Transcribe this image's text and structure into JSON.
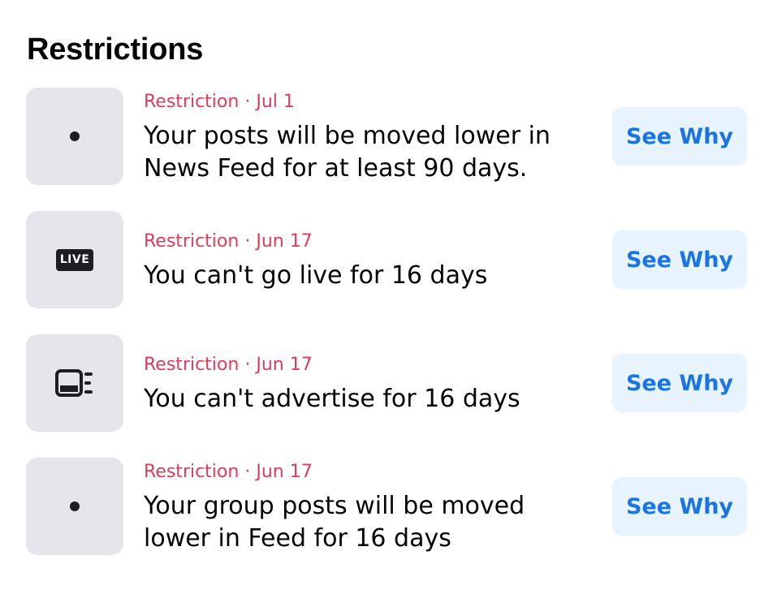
{
  "title": "Restrictions",
  "items": [
    {
      "type": "Restriction",
      "separator": "·",
      "date": "Jul 1",
      "line1": "Your posts will be moved lower in",
      "line2": "News Feed for at least 90 days.",
      "icon": "dot-icon",
      "button": "See Why"
    },
    {
      "type": "Restriction",
      "separator": "·",
      "date": "Jun 17",
      "line1": "You can't go live for 16 days",
      "line2": "",
      "icon": "live-icon",
      "icon_text": "LIVE",
      "button": "See Why"
    },
    {
      "type": "Restriction",
      "separator": "·",
      "date": "Jun 17",
      "line1": "You can't advertise for 16 days",
      "line2": "",
      "icon": "ad-icon",
      "button": "See Why"
    },
    {
      "type": "Restriction",
      "separator": "·",
      "date": "Jun 17",
      "line1": "Your group posts will be moved",
      "line2": "lower in Feed for 16 days",
      "icon": "dot-icon",
      "button": "See Why"
    }
  ],
  "colors": {
    "meta": "#dd3c5a",
    "button_bg": "#e7f3ff",
    "button_text": "#1b74e4",
    "thumb_bg": "#e4e6eb"
  }
}
